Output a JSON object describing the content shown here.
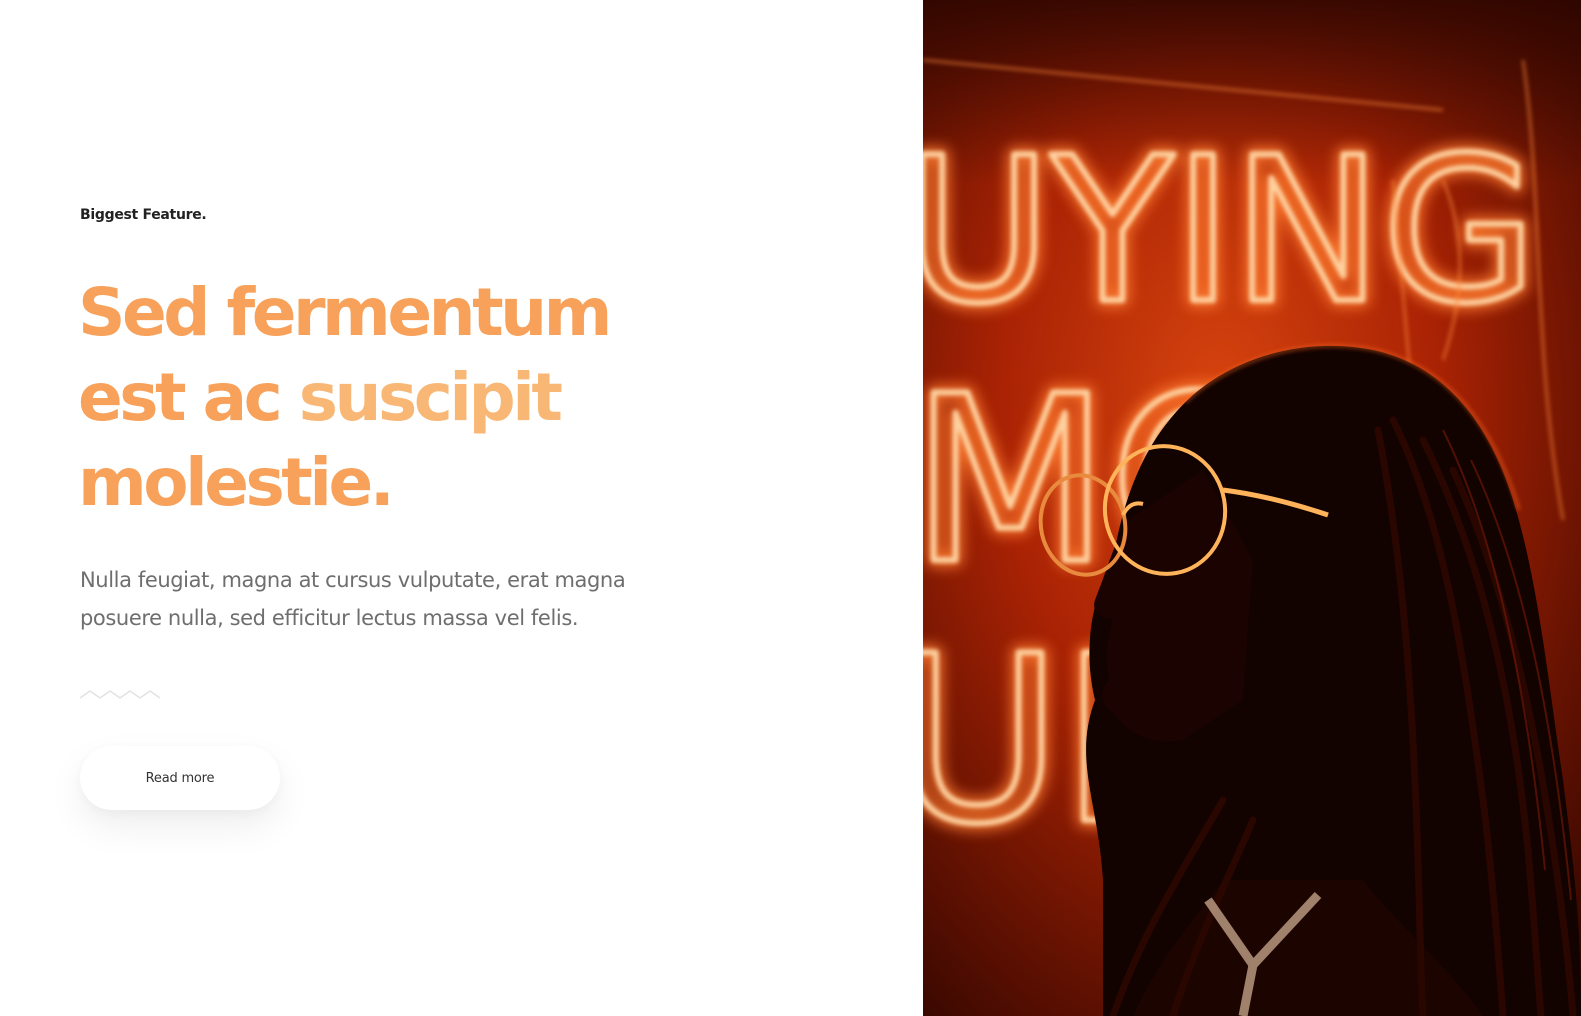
{
  "feature": {
    "eyebrow": "Biggest Feature.",
    "headline": {
      "line1": "Sed fermentum",
      "line2_a": "est ac",
      "line2_b": "suscipit",
      "line3": "molestie."
    },
    "description_line1": "Nulla feugiat, magna at cursus vulputate, erat magna",
    "description_line2": "posuere nulla, sed efficitur lectus massa vel felis.",
    "button_label": "Read more"
  },
  "photo": {
    "neon_row1": "UYING",
    "neon_row2": "MO",
    "neon_row3": "UE"
  },
  "colors": {
    "accent": "#f7a15a",
    "accent_light": "#f9b775",
    "body_text": "#6e6e6e",
    "neon": "#ffb56b"
  }
}
